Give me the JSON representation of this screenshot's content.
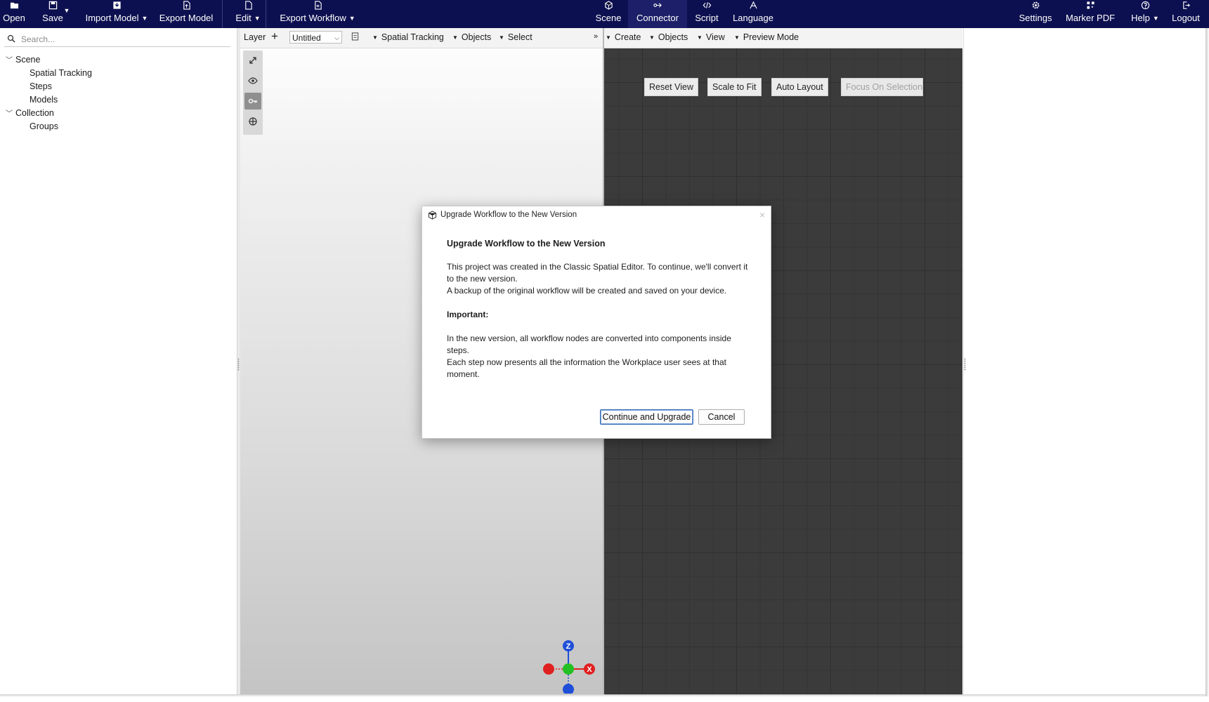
{
  "menubar": {
    "open": "Open",
    "save": "Save",
    "import_model": "Import Model",
    "export_model": "Export Model",
    "edit": "Edit",
    "export_workflow": "Export Workflow",
    "scene": "Scene",
    "connector": "Connector",
    "script": "Script",
    "language": "Language",
    "settings": "Settings",
    "marker_pdf": "Marker PDF",
    "help": "Help",
    "logout": "Logout",
    "active_tab": "Connector"
  },
  "sidebar": {
    "search_placeholder": "Search...",
    "tree": [
      {
        "label": "Scene",
        "expanded": true
      },
      {
        "label": "Spatial Tracking"
      },
      {
        "label": "Steps"
      },
      {
        "label": "Models"
      },
      {
        "label": "Collection",
        "expanded": true
      },
      {
        "label": "Groups"
      }
    ]
  },
  "viewport_toolbar": {
    "layer_label": "Layer",
    "layer_value": "Untitled",
    "spatial_tracking": "Spatial Tracking",
    "objects": "Objects",
    "select": "Select"
  },
  "viewport_tools": [
    "expand-icon",
    "eye-icon",
    "key-icon",
    "move-icon"
  ],
  "gizmo": {
    "z": "Z",
    "x": "X"
  },
  "node_editor": {
    "toolbar": {
      "create": "Create",
      "objects": "Objects",
      "view": "View",
      "preview_mode": "Preview Mode"
    },
    "buttons": {
      "reset_view": "Reset View",
      "scale_to_fit": "Scale to Fit",
      "auto_layout": "Auto Layout",
      "focus_on_selection": "Focus On Selection"
    }
  },
  "dialog": {
    "window_title": "Upgrade Workflow to the New Version",
    "heading": "Upgrade Workflow to the New Version",
    "para1": "This project was created in the Classic Spatial Editor. To continue, we'll convert it to the new version.",
    "para2": "A backup of the original workflow will be created and saved on your device.",
    "important_label": "Important:",
    "para3": "In the new version, all workflow nodes are converted into components inside steps.",
    "para4": "Each step now presents all the information the Workplace user sees at that moment.",
    "continue_button": "Continue and Upgrade",
    "cancel_button": "Cancel",
    "close_glyph": "×"
  },
  "colors": {
    "menubar_bg": "#0d1050",
    "node_canvas_bg": "#3b3b3b",
    "gizmo_x": "#e02020",
    "gizmo_y": "#22c022",
    "gizmo_z": "#1f4fd8",
    "primary_button_border": "#3a6fb5"
  }
}
